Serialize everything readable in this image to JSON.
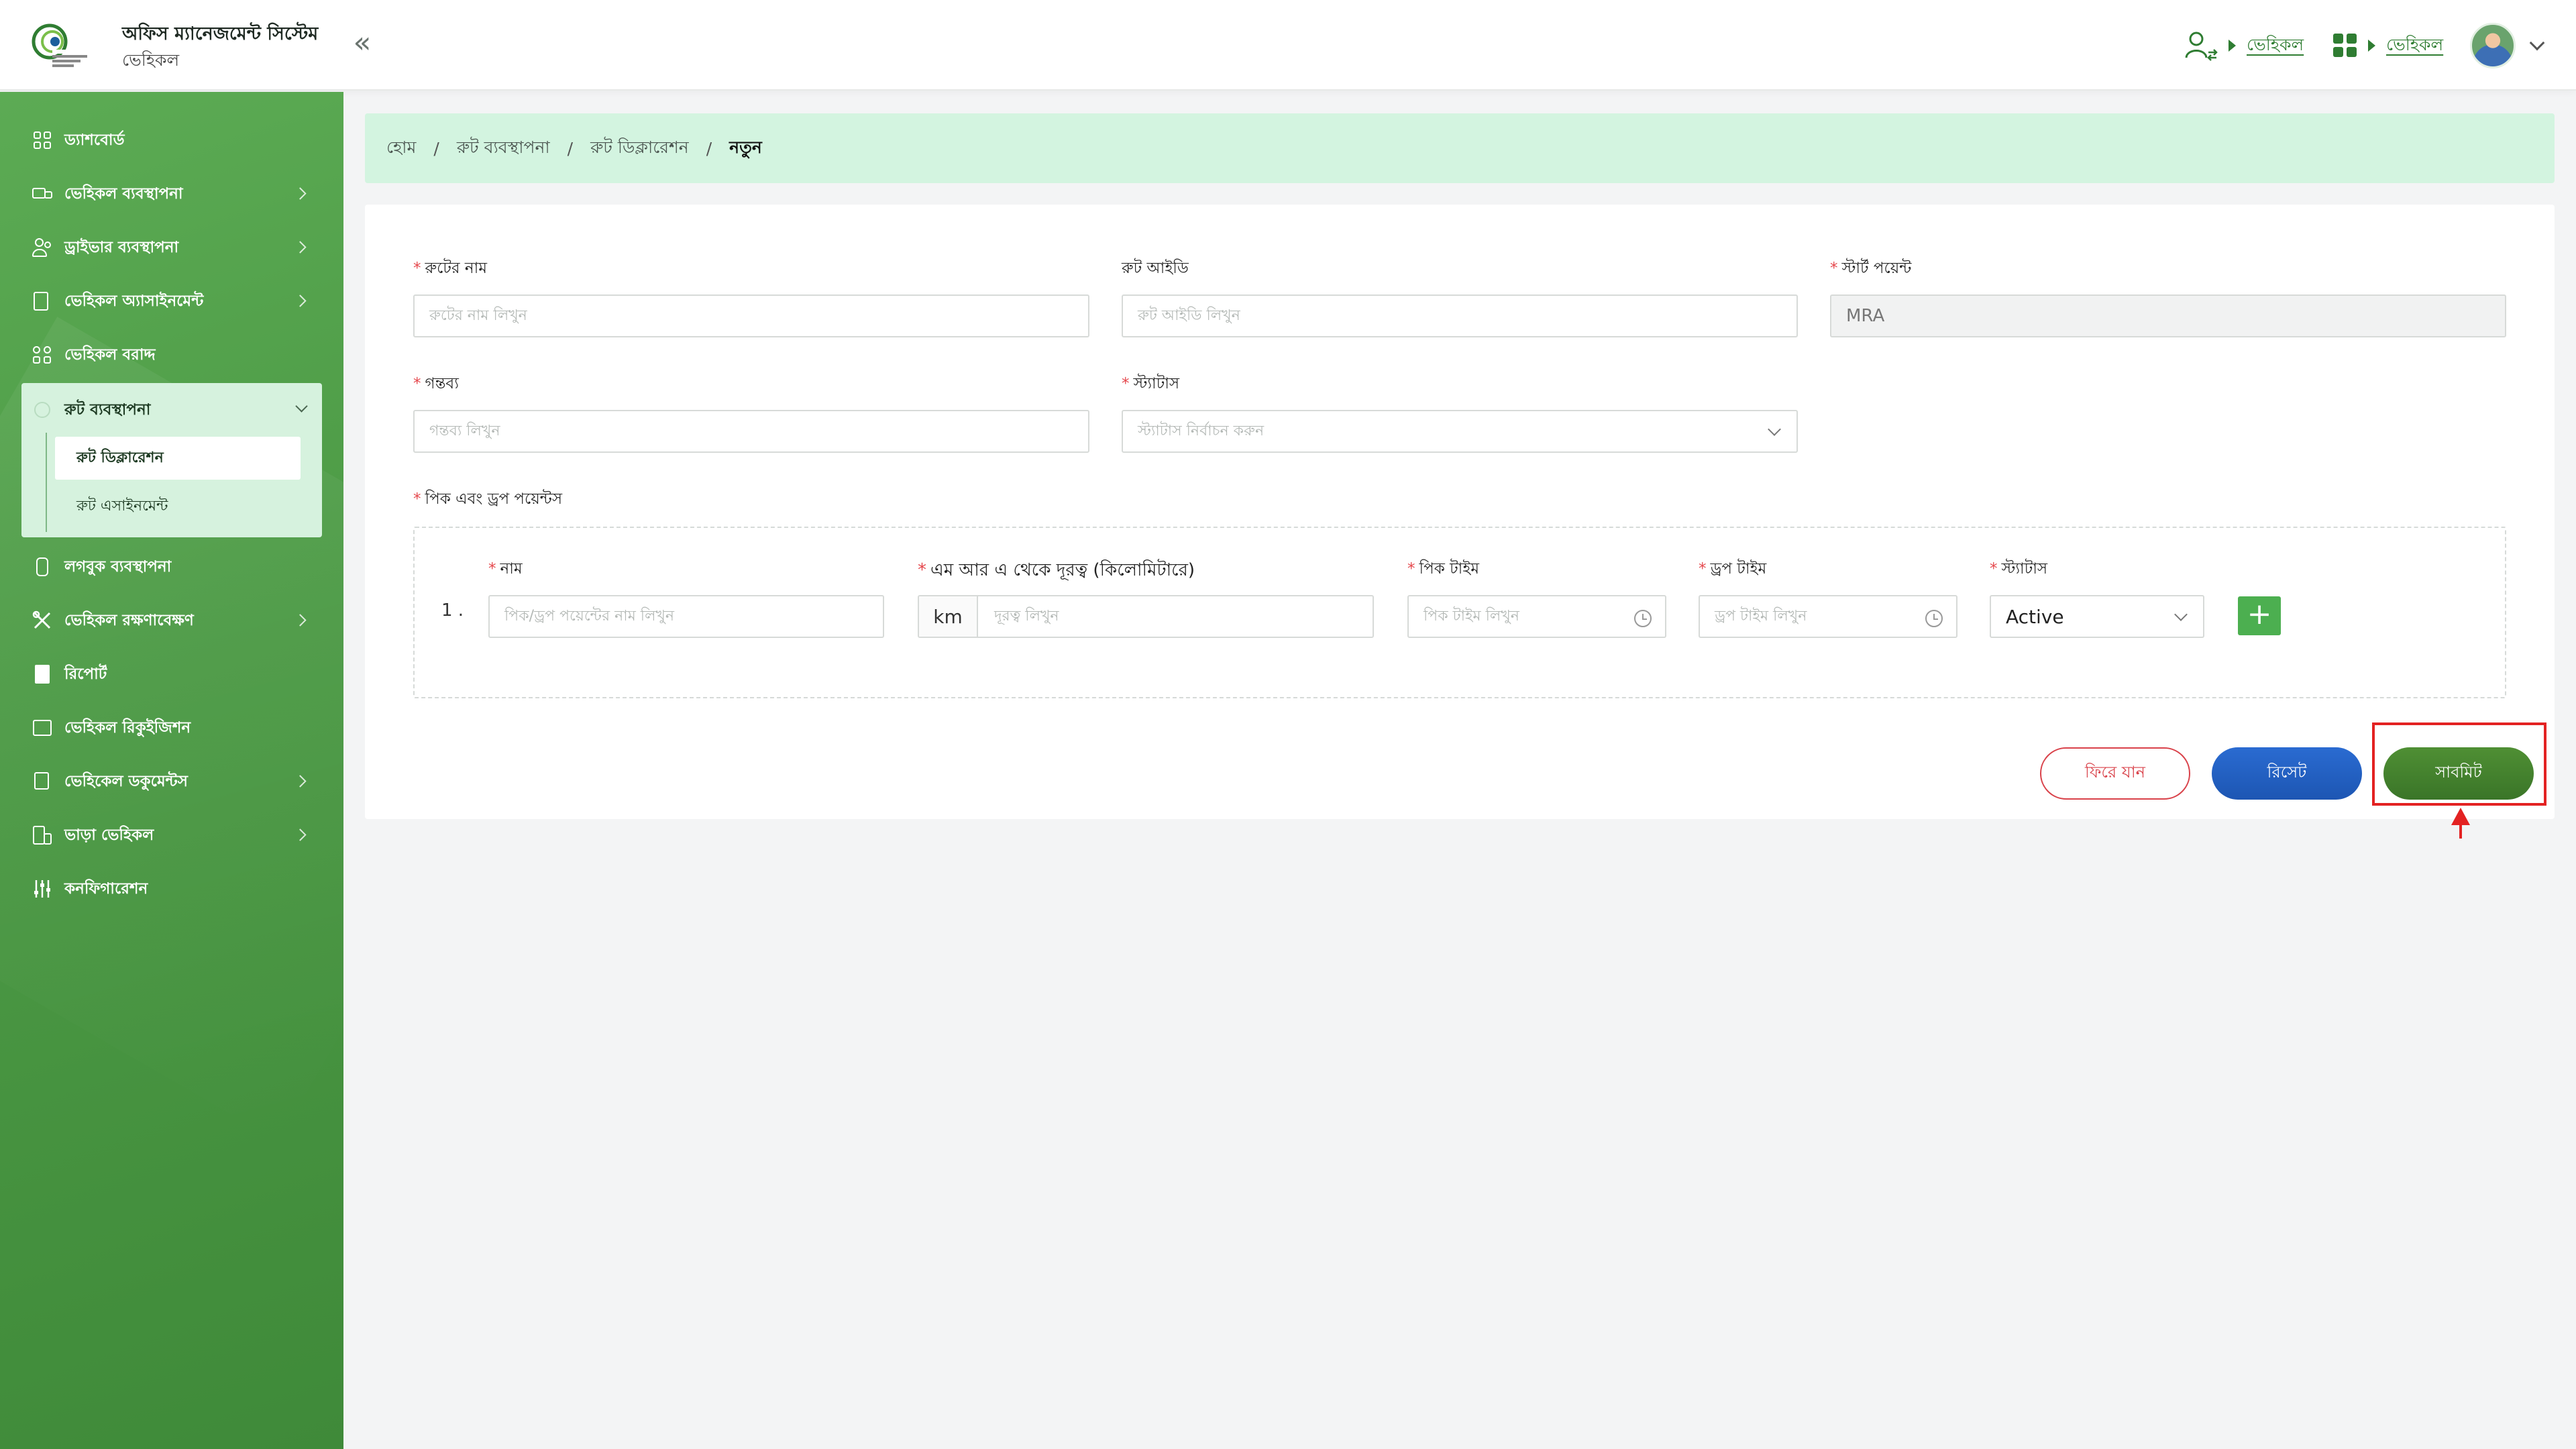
{
  "header": {
    "app_title": "অফিস ম্যানেজমেন্ট সিস্টেম",
    "app_subtitle": "ভেহিকল",
    "collapse_icon": "double-chevron-left-icon",
    "user_role_link": "ভেহিকল",
    "module_link": "ভেহিকল"
  },
  "sidebar": {
    "items": [
      {
        "label": "ড্যাশবোর্ড",
        "icon": "dashboard-icon",
        "has_children": false
      },
      {
        "label": "ভেহিকল ব্যবস্থাপনা",
        "icon": "vehicle-icon",
        "has_children": true
      },
      {
        "label": "ড্রাইভার ব্যবস্থাপনা",
        "icon": "driver-icon",
        "has_children": true
      },
      {
        "label": "ভেহিকল অ্যাসাইনমেন্ট",
        "icon": "assignment-icon",
        "has_children": true
      },
      {
        "label": "ভেহিকল বরাদ্দ",
        "icon": "allocation-icon",
        "has_children": false
      }
    ],
    "active_group": {
      "label": "রুট ব্যবস্থাপনা",
      "icon": "route-icon",
      "children": [
        {
          "label": "রুট ডিক্লারেশন",
          "active": true
        },
        {
          "label": "রুট এসাইনমেন্ট",
          "active": false
        }
      ]
    },
    "items_after": [
      {
        "label": "লগবুক ব্যবস্থাপনা",
        "icon": "logbook-icon",
        "has_children": false
      },
      {
        "label": "ভেহিকল রক্ষণাবেক্ষণ",
        "icon": "maintenance-icon",
        "has_children": true
      },
      {
        "label": "রিপোর্ট",
        "icon": "report-icon",
        "has_children": false
      },
      {
        "label": "ভেহিকল রিকুইজিশন",
        "icon": "requisition-icon",
        "has_children": false
      },
      {
        "label": "ভেহিকেল ডকুমেন্টস",
        "icon": "documents-icon",
        "has_children": true
      },
      {
        "label": "ভাড়া ভেহিকল",
        "icon": "rental-icon",
        "has_children": true
      },
      {
        "label": "কনফিগারেশন",
        "icon": "config-icon",
        "has_children": false
      }
    ]
  },
  "breadcrumb": {
    "items": [
      "হোম",
      "রুট ব্যবস্থাপনা",
      "রুট ডিক্লারেশন"
    ],
    "current": "নতুন",
    "separator": "/"
  },
  "form": {
    "route_name": {
      "label": "রুটের নাম",
      "placeholder": "রুটের নাম লিখুন",
      "required": true
    },
    "route_id": {
      "label": "রুট আইডি",
      "placeholder": "রুট আইডি লিখুন",
      "required": false
    },
    "start_point": {
      "label": "স্টার্ট পয়েন্ট",
      "value": "MRA",
      "required": true
    },
    "destination": {
      "label": "গন্তব্য",
      "placeholder": "গন্তব্য লিখুন",
      "required": true
    },
    "status": {
      "label": "স্ট্যাটাস",
      "placeholder": "স্ট্যাটাস নির্বাচন করুন",
      "required": true
    },
    "pick_drop": {
      "label": "পিক এবং ড্রপ পয়েন্টস",
      "columns": {
        "name": "নাম",
        "distance": "এম আর এ থেকে দূরত্ব (কিলোমিটারে)",
        "pick_time": "পিক টাইম",
        "drop_time": "ড্রপ টাইম",
        "status": "স্ট্যাটাস"
      },
      "rows": [
        {
          "index": "1 .",
          "name_placeholder": "পিক/ড্রপ পয়েন্টের নাম লিখুন",
          "distance_unit": "km",
          "distance_placeholder": "দূরত্ব লিখুন",
          "pick_time_placeholder": "পিক টাইম লিখুন",
          "drop_time_placeholder": "ড্রপ টাইম লিখুন",
          "status_value": "Active"
        }
      ],
      "add_label": "+"
    },
    "buttons": {
      "back": "ফিরে যান",
      "reset": "রিসেট",
      "submit": "সাবমিট"
    }
  },
  "colors": {
    "brand_green": "#4d9b46",
    "breadcrumb_bg": "#d3f4e0",
    "danger": "#d9424a",
    "primary_blue": "#1d56b3",
    "submit_green": "#3a7528",
    "highlight_red": "#e32222"
  }
}
